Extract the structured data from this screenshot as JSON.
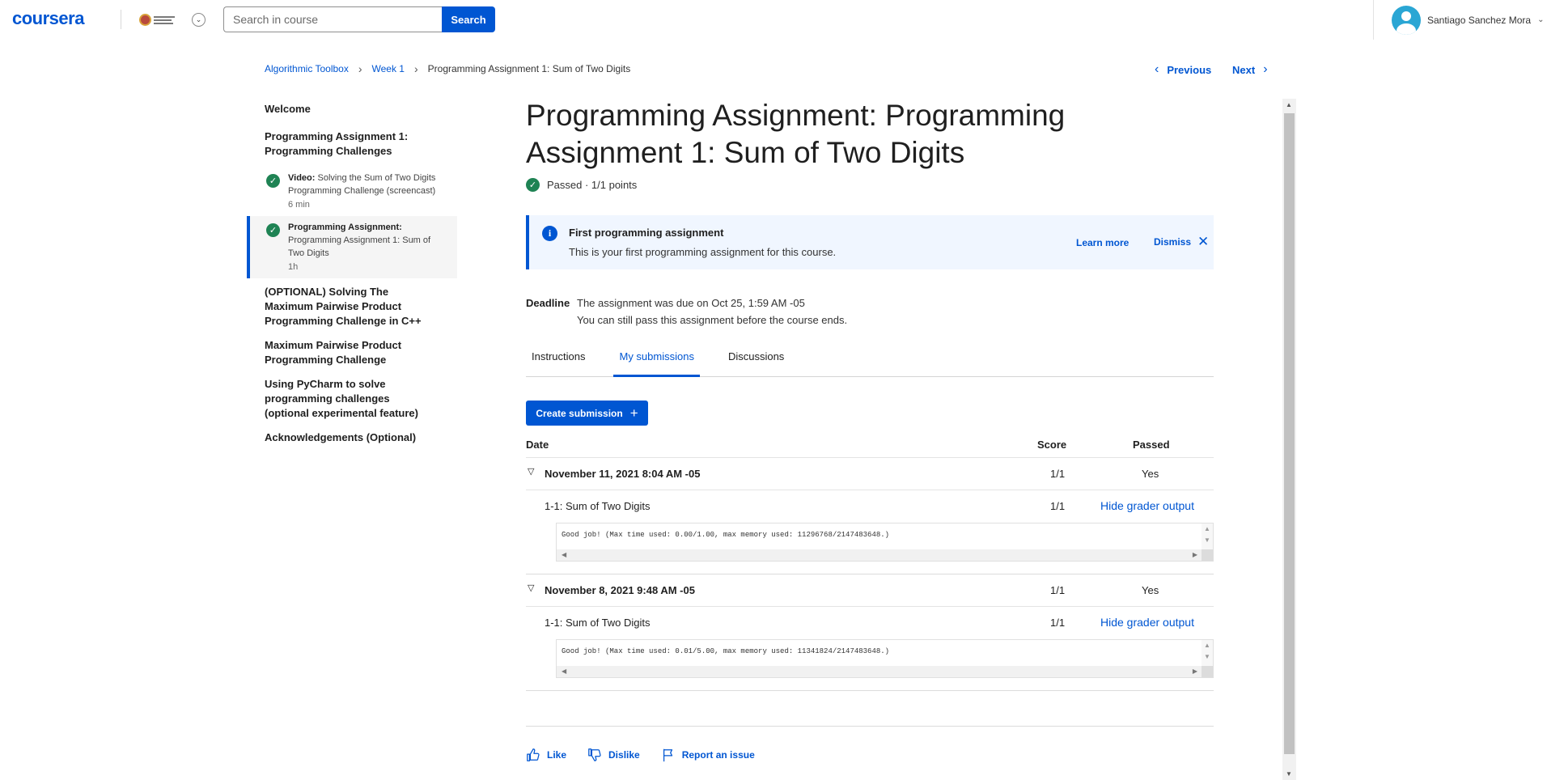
{
  "header": {
    "logo": "coursera",
    "search_placeholder": "Search in course",
    "search_button": "Search",
    "user_name": "Santiago Sanchez Mora"
  },
  "breadcrumb": {
    "items": [
      "Algorithmic Toolbox",
      "Week 1"
    ],
    "current": "Programming Assignment 1: Sum of Two Digits"
  },
  "pager": {
    "previous": "Previous",
    "next": "Next"
  },
  "nav": {
    "welcome": "Welcome",
    "section_pa": "Programming Assignment 1: Programming Challenges",
    "item_video": {
      "kind": "Video:",
      "title": "Solving the Sum of Two Digits Programming Challenge (screencast)",
      "duration": "6 min"
    },
    "item_assignment": {
      "kind": "Programming Assignment:",
      "title": "Programming Assignment 1: Sum of Two Digits",
      "duration": "1h"
    },
    "optional_max": "(OPTIONAL) Solving The Maximum Pairwise Product Programming Challenge in C++",
    "max_pairwise": "Maximum Pairwise Product Programming Challenge",
    "pycharm": "Using PyCharm to solve programming challenges (optional experimental feature)",
    "ack": "Acknowledgements (Optional)"
  },
  "main": {
    "title": "Programming Assignment: Programming Assignment 1: Sum of Two Digits",
    "status": "Passed · 1/1 points",
    "banner": {
      "title": "First programming assignment",
      "text": "This is your first programming assignment for this course.",
      "learn_more": "Learn more",
      "dismiss": "Dismiss"
    },
    "deadline": {
      "label": "Deadline",
      "line1": "The assignment was due on Oct 25, 1:59 AM -05",
      "line2": "You can still pass this assignment before the course ends."
    },
    "tabs": [
      "Instructions",
      "My submissions",
      "Discussions"
    ],
    "create_submission": "Create submission",
    "table_headers": {
      "date": "Date",
      "score": "Score",
      "passed": "Passed"
    },
    "submissions": [
      {
        "date": "November 11, 2021 8:04 AM -05",
        "score": "1/1",
        "passed": "Yes",
        "part_name": "1-1: Sum of Two Digits",
        "part_score": "1/1",
        "toggle": "Hide grader output",
        "output": "Good job! (Max time used: 0.00/1.00, max memory used: 11296768/2147483648.)"
      },
      {
        "date": "November 8, 2021 9:48 AM -05",
        "score": "1/1",
        "passed": "Yes",
        "part_name": "1-1: Sum of Two Digits",
        "part_score": "1/1",
        "toggle": "Hide grader output",
        "output": "Good job! (Max time used: 0.01/5.00, max memory used: 11341824/2147483648.)"
      }
    ],
    "feedback": {
      "like": "Like",
      "dislike": "Dislike",
      "report": "Report an issue"
    }
  },
  "colors": {
    "brand": "#0056d2",
    "success": "#1f8354",
    "banner_bg": "#f0f6ff"
  }
}
